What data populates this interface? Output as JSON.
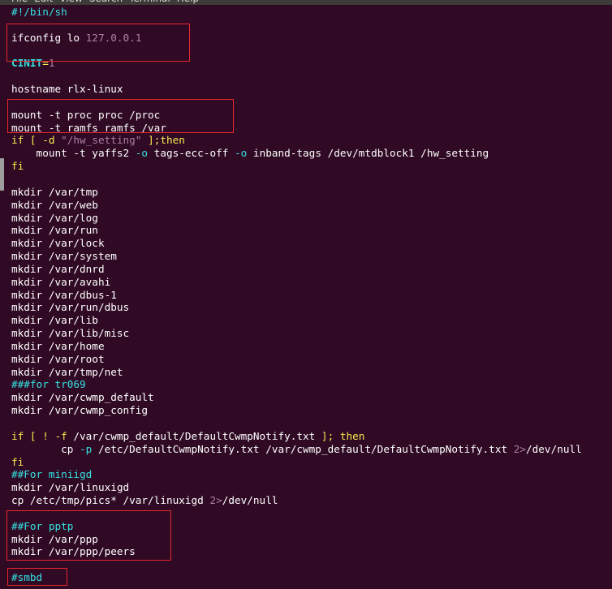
{
  "window": {
    "menu": [
      "File",
      "Edit",
      "View",
      "Search",
      "Terminal",
      "Help"
    ]
  },
  "lines": [
    {
      "segs": [
        {
          "t": "#!/bin/sh",
          "c": "comment"
        }
      ]
    },
    {
      "segs": []
    },
    {
      "segs": [
        {
          "t": "ifconfig lo ",
          "c": ""
        },
        {
          "t": "127.0.0.1",
          "c": "special"
        }
      ]
    },
    {
      "segs": []
    },
    {
      "segs": [
        {
          "t": "CINIT",
          "c": "var-bold"
        },
        {
          "t": "=",
          "c": "op"
        },
        {
          "t": "1",
          "c": "special"
        }
      ]
    },
    {
      "segs": []
    },
    {
      "segs": [
        {
          "t": "hostname rlx-linux",
          "c": ""
        }
      ]
    },
    {
      "segs": []
    },
    {
      "segs": [
        {
          "t": "mount -t proc proc /proc",
          "c": ""
        }
      ]
    },
    {
      "segs": [
        {
          "t": "mount -t ramfs ramfs /var",
          "c": ""
        }
      ]
    },
    {
      "segs": [
        {
          "t": "if",
          "c": "keyword"
        },
        {
          "t": " [ -d ",
          "c": "keyword"
        },
        {
          "t": "\"/hw_setting\"",
          "c": "string"
        },
        {
          "t": " ];then",
          "c": "keyword"
        }
      ]
    },
    {
      "segs": [
        {
          "t": "    mount -t yaffs2 ",
          "c": ""
        },
        {
          "t": "-o",
          "c": "flag"
        },
        {
          "t": " tags-ecc-off ",
          "c": ""
        },
        {
          "t": "-o",
          "c": "flag"
        },
        {
          "t": " inband-tags /dev/mtdblock1 /hw_setting",
          "c": ""
        }
      ]
    },
    {
      "segs": [
        {
          "t": "fi",
          "c": "keyword"
        }
      ]
    },
    {
      "segs": []
    },
    {
      "segs": [
        {
          "t": "mkdir /var/tmp",
          "c": ""
        }
      ]
    },
    {
      "segs": [
        {
          "t": "mkdir /var/web",
          "c": ""
        }
      ]
    },
    {
      "segs": [
        {
          "t": "mkdir /var/log",
          "c": ""
        }
      ]
    },
    {
      "segs": [
        {
          "t": "mkdir /var/run",
          "c": ""
        }
      ]
    },
    {
      "segs": [
        {
          "t": "mkdir /var/lock",
          "c": ""
        }
      ]
    },
    {
      "segs": [
        {
          "t": "mkdir /var/system",
          "c": ""
        }
      ]
    },
    {
      "segs": [
        {
          "t": "mkdir /var/dnrd",
          "c": ""
        }
      ]
    },
    {
      "segs": [
        {
          "t": "mkdir /var/avahi",
          "c": ""
        }
      ]
    },
    {
      "segs": [
        {
          "t": "mkdir /var/dbus-1",
          "c": ""
        }
      ]
    },
    {
      "segs": [
        {
          "t": "mkdir /var/run/dbus",
          "c": ""
        }
      ]
    },
    {
      "segs": [
        {
          "t": "mkdir /var/lib",
          "c": ""
        }
      ]
    },
    {
      "segs": [
        {
          "t": "mkdir /var/lib/misc",
          "c": ""
        }
      ]
    },
    {
      "segs": [
        {
          "t": "mkdir /var/home",
          "c": ""
        }
      ]
    },
    {
      "segs": [
        {
          "t": "mkdir /var/root",
          "c": ""
        }
      ]
    },
    {
      "segs": [
        {
          "t": "mkdir /var/tmp/net",
          "c": ""
        }
      ]
    },
    {
      "segs": [
        {
          "t": "###for tr069",
          "c": "comment"
        }
      ]
    },
    {
      "segs": [
        {
          "t": "mkdir /var/cwmp_default",
          "c": ""
        }
      ]
    },
    {
      "segs": [
        {
          "t": "mkdir /var/cwmp_config",
          "c": ""
        }
      ]
    },
    {
      "segs": []
    },
    {
      "segs": [
        {
          "t": "if",
          "c": "keyword"
        },
        {
          "t": " [ ! -f ",
          "c": "keyword"
        },
        {
          "t": "/var/cwmp_default/DefaultCwmpNotify.txt",
          "c": ""
        },
        {
          "t": " ]; then",
          "c": "keyword"
        }
      ]
    },
    {
      "segs": [
        {
          "t": "        cp ",
          "c": ""
        },
        {
          "t": "-p",
          "c": "flag"
        },
        {
          "t": " /etc/DefaultCwmpNotify.txt /var/cwmp_default/DefaultCwmpNotify.txt ",
          "c": ""
        },
        {
          "t": "2>",
          "c": "special"
        },
        {
          "t": "/dev/null",
          "c": ""
        }
      ]
    },
    {
      "segs": [
        {
          "t": "fi",
          "c": "keyword"
        }
      ]
    },
    {
      "segs": [
        {
          "t": "##For miniigd",
          "c": "comment"
        }
      ]
    },
    {
      "segs": [
        {
          "t": "mkdir /var/linuxigd",
          "c": ""
        }
      ]
    },
    {
      "segs": [
        {
          "t": "cp /etc/tmp/pics* /var/linuxigd ",
          "c": ""
        },
        {
          "t": "2>",
          "c": "special"
        },
        {
          "t": "/dev/null",
          "c": ""
        }
      ]
    },
    {
      "segs": []
    },
    {
      "segs": [
        {
          "t": "##For pptp",
          "c": "comment"
        }
      ]
    },
    {
      "segs": [
        {
          "t": "mkdir /var/ppp",
          "c": ""
        }
      ]
    },
    {
      "segs": [
        {
          "t": "mkdir /var/ppp/peers",
          "c": ""
        }
      ]
    },
    {
      "segs": []
    },
    {
      "segs": [
        {
          "t": "#smbd",
          "c": "comment"
        }
      ]
    }
  ]
}
